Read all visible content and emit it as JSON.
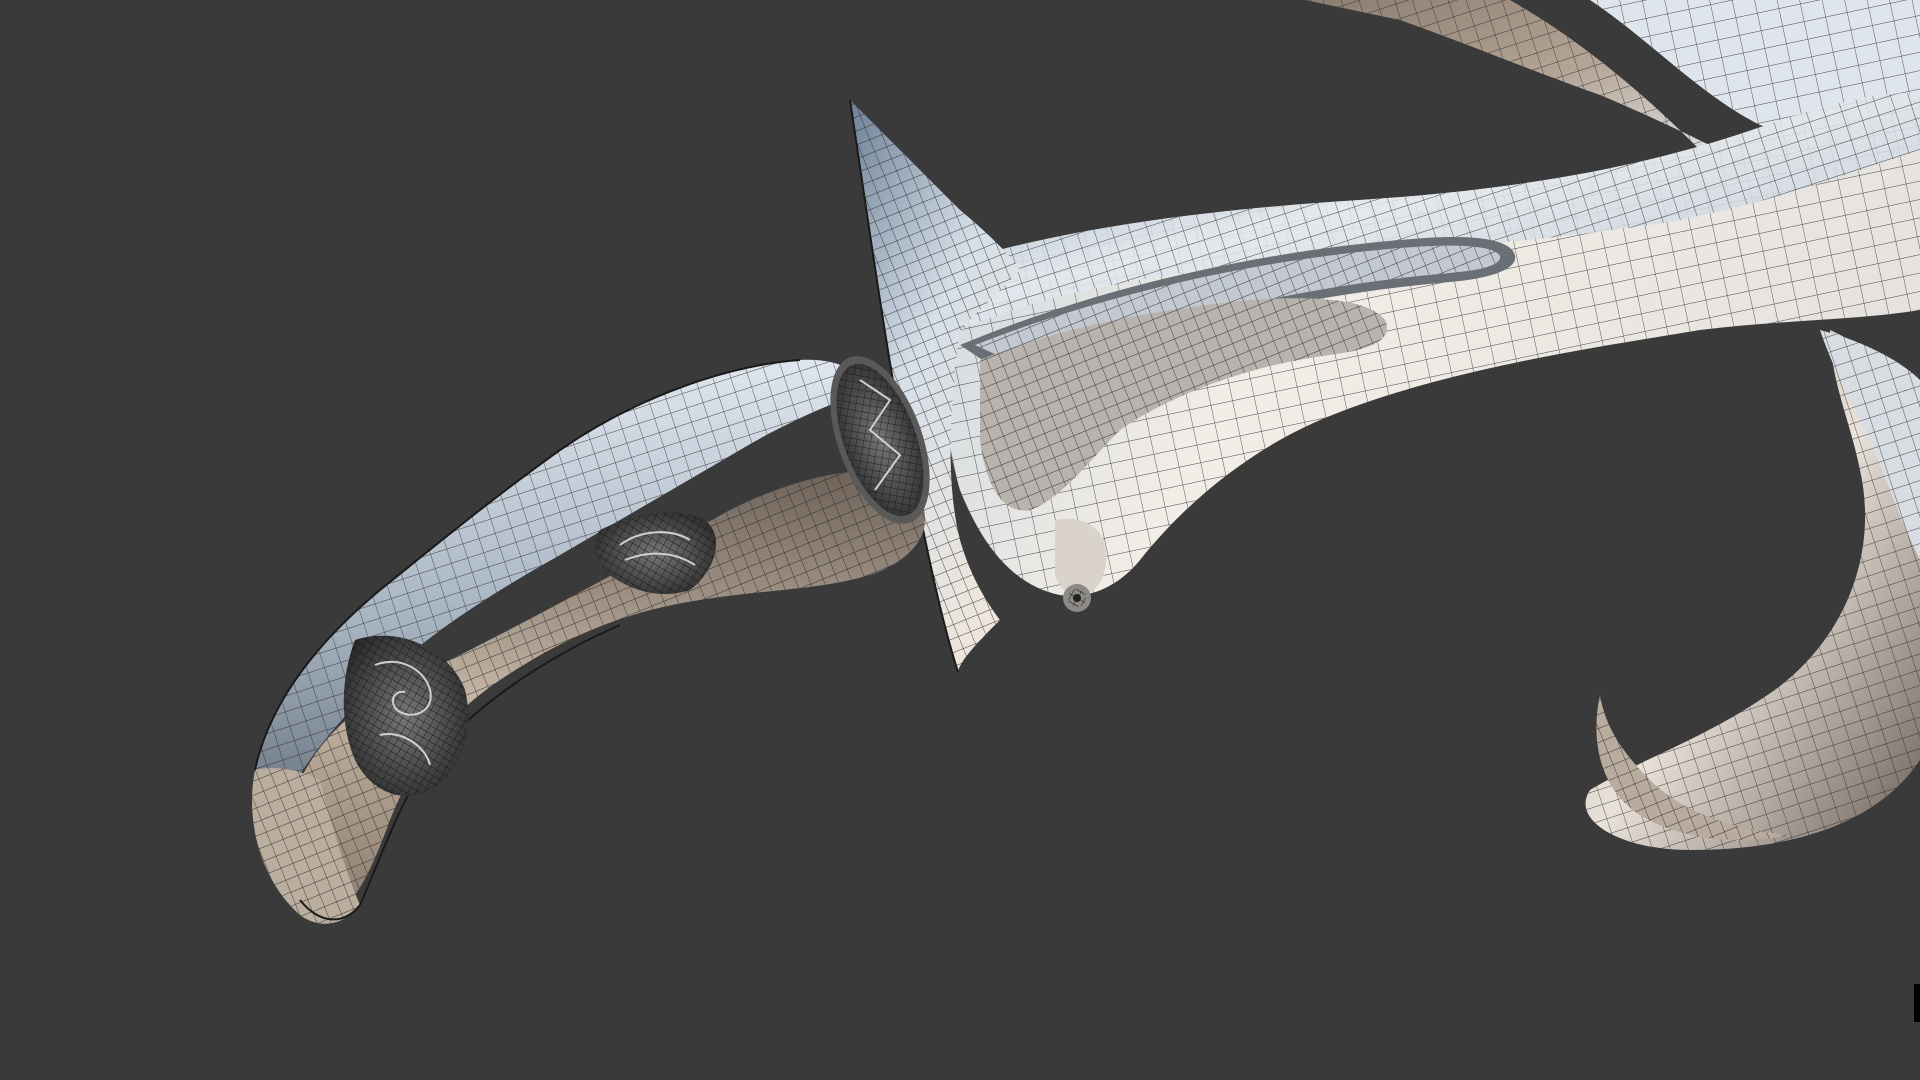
{
  "viewport": {
    "background_color": "#3a3a3a",
    "model_subject": "wireframe-dagger-model",
    "wire_color": "#1f1f1f",
    "shading": {
      "metal_light": "#e8ebee",
      "metal_mid": "#9fb0c2",
      "metal_dark": "#5c6773",
      "warm_light": "#f4ece2",
      "warm_mid": "#b9a999",
      "warm_dark": "#5a4e44"
    }
  }
}
